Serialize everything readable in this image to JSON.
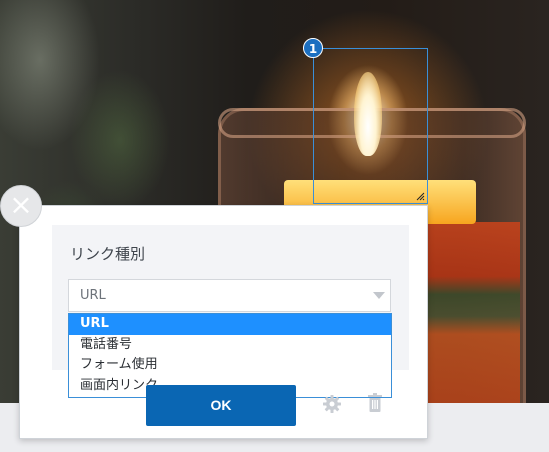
{
  "hotspot": {
    "badge": "1"
  },
  "dialog": {
    "close_symbol": "×",
    "link_type_label": "リンク種別",
    "select_value": "URL",
    "options": [
      "URL",
      "電話番号",
      "フォーム使用",
      "画面内リンク"
    ],
    "selected_index": 0,
    "ok_label": "OK"
  },
  "icons": {
    "settings": "gear-icon",
    "delete": "trash-icon",
    "dropdown": "chevron-down-icon",
    "resize": "resize-handle-icon"
  },
  "colors": {
    "accent": "#0a66b3",
    "option_highlight": "#1e90ff",
    "hotspot_border": "#3a8fd8"
  }
}
